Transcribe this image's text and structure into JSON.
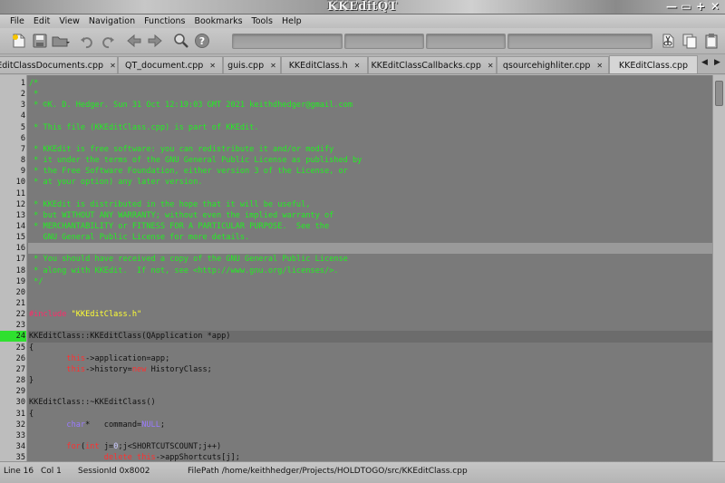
{
  "window": {
    "title": "KKEditQT",
    "controls": [
      "—",
      "▭",
      "+",
      "✕"
    ]
  },
  "menu": [
    "File",
    "Edit",
    "View",
    "Navigation",
    "Functions",
    "Bookmarks",
    "Tools",
    "Help"
  ],
  "toolbar": {
    "icons": [
      "new-file-icon",
      "save-icon",
      "open-folder-icon",
      "undo-icon",
      "redo-icon",
      "back-icon",
      "forward-icon",
      "find-icon",
      "help-icon"
    ],
    "right_icons": [
      "cut-icon",
      "copy-icon",
      "paste-icon"
    ]
  },
  "tabs": [
    {
      "label": "EditClassDocuments.cpp",
      "close": "✕"
    },
    {
      "label": "QT_document.cpp",
      "close": "✕"
    },
    {
      "label": "guis.cpp",
      "close": "✕"
    },
    {
      "label": "KKEditClass.h",
      "close": "✕"
    },
    {
      "label": "KKEditClassCallbacks.cpp",
      "close": "✕"
    },
    {
      "label": "qsourcehighliter.cpp",
      "close": "✕"
    },
    {
      "label": "KKEditClass.cpp",
      "close": "",
      "active": true
    }
  ],
  "tab_scroll": {
    "left": "◀",
    "right": "▶"
  },
  "editor": {
    "current_line": 24,
    "highlight_line": 16,
    "lines": [
      {
        "n": "1",
        "parts": [
          [
            "c",
            "/*"
          ]
        ]
      },
      {
        "n": "2",
        "parts": [
          [
            "c",
            " *"
          ]
        ]
      },
      {
        "n": "3",
        "parts": [
          [
            "c",
            " * ©K. D. Hedger. Sun 31 Oct 12:19:03 GMT 2021 keithdhedger@gmail.com"
          ]
        ]
      },
      {
        "n": "4",
        "parts": [
          [
            "c",
            ""
          ]
        ]
      },
      {
        "n": "5",
        "parts": [
          [
            "c",
            " * This file (KKEditClass.cpp) is part of KKEdit."
          ]
        ]
      },
      {
        "n": "6",
        "parts": [
          [
            "c",
            ""
          ]
        ]
      },
      {
        "n": "7",
        "parts": [
          [
            "c",
            " * KKEdit is free software: you can redistribute it and/or modify"
          ]
        ]
      },
      {
        "n": "8",
        "parts": [
          [
            "c",
            " * it under the terms of the GNU General Public License as published by"
          ]
        ]
      },
      {
        "n": "9",
        "parts": [
          [
            "c",
            " * the Free Software Foundation, either version 3 of the License, or"
          ]
        ]
      },
      {
        "n": "10",
        "parts": [
          [
            "c",
            " * at your option) any later version."
          ]
        ]
      },
      {
        "n": "11",
        "parts": [
          [
            "c",
            ""
          ]
        ]
      },
      {
        "n": "12",
        "parts": [
          [
            "c",
            " * KKEdit is distributed in the hope that it will be useful,"
          ]
        ]
      },
      {
        "n": "13",
        "parts": [
          [
            "c",
            " * but WITHOUT ANY WARRANTY; without even the implied warranty of"
          ]
        ]
      },
      {
        "n": "14",
        "parts": [
          [
            "c",
            " * MERCHANTABILITY or FITNESS FOR A PARTICULAR PURPOSE.  See the"
          ]
        ]
      },
      {
        "n": "15",
        "parts": [
          [
            "c",
            "   GNU General Public License for more details."
          ]
        ]
      },
      {
        "n": "16",
        "parts": [
          [
            "c",
            ""
          ]
        ]
      },
      {
        "n": "17",
        "parts": [
          [
            "c",
            " * You should have received a copy of the GNU General Public License"
          ]
        ]
      },
      {
        "n": "18",
        "parts": [
          [
            "c",
            " * along with KKEdit.  If not, see <http://www.gnu.org/licenses/>."
          ]
        ]
      },
      {
        "n": "19",
        "parts": [
          [
            "c",
            " */"
          ]
        ]
      },
      {
        "n": "20",
        "parts": [
          [
            "d",
            ""
          ]
        ]
      },
      {
        "n": "21",
        "parts": [
          [
            "d",
            ""
          ]
        ]
      },
      {
        "n": "22",
        "parts": [
          [
            "p",
            "#include "
          ],
          [
            "s",
            "\"KKEditClass.h\""
          ]
        ]
      },
      {
        "n": "23",
        "parts": [
          [
            "d",
            ""
          ]
        ]
      },
      {
        "n": "24",
        "parts": [
          [
            "d",
            "KKEditClass::KKEditClass(QApplication *app)"
          ]
        ]
      },
      {
        "n": "25",
        "parts": [
          [
            "d",
            "{"
          ]
        ]
      },
      {
        "n": "26",
        "parts": [
          [
            "d",
            "        "
          ],
          [
            "k",
            "this"
          ],
          [
            "d",
            "->application=app;"
          ]
        ]
      },
      {
        "n": "27",
        "parts": [
          [
            "d",
            "        "
          ],
          [
            "k",
            "this"
          ],
          [
            "d",
            "->history="
          ],
          [
            "k",
            "new"
          ],
          [
            "d",
            " HistoryClass;"
          ]
        ]
      },
      {
        "n": "28",
        "parts": [
          [
            "d",
            "}"
          ]
        ]
      },
      {
        "n": "29",
        "parts": [
          [
            "d",
            ""
          ]
        ]
      },
      {
        "n": "30",
        "parts": [
          [
            "d",
            "KKEditClass::~KKEditClass()"
          ]
        ]
      },
      {
        "n": "31",
        "parts": [
          [
            "d",
            "{"
          ]
        ]
      },
      {
        "n": "32",
        "parts": [
          [
            "d",
            "        "
          ],
          [
            "t",
            "char"
          ],
          [
            "d",
            "*   command="
          ],
          [
            "t",
            "NULL"
          ],
          [
            "d",
            ";"
          ]
        ]
      },
      {
        "n": "33",
        "parts": [
          [
            "d",
            ""
          ]
        ]
      },
      {
        "n": "34",
        "parts": [
          [
            "d",
            "        "
          ],
          [
            "k",
            "for"
          ],
          [
            "d",
            "("
          ],
          [
            "k",
            "int"
          ],
          [
            "d",
            " j="
          ],
          [
            "n",
            "0"
          ],
          [
            "d",
            ";j<SHORTCUTSCOUNT;j++)"
          ]
        ]
      },
      {
        "n": "35",
        "parts": [
          [
            "d",
            "                "
          ],
          [
            "k",
            "delete"
          ],
          [
            "d",
            " "
          ],
          [
            "k",
            "this"
          ],
          [
            "d",
            "->appShortcuts[j];"
          ]
        ]
      }
    ]
  },
  "status": {
    "line": "Line 16",
    "col": "Col 1",
    "session": "SessionId 0x8002",
    "filepath": "FilePath /home/keithhedger/Projects/HOLDTOGO/src/KKEditClass.cpp"
  }
}
